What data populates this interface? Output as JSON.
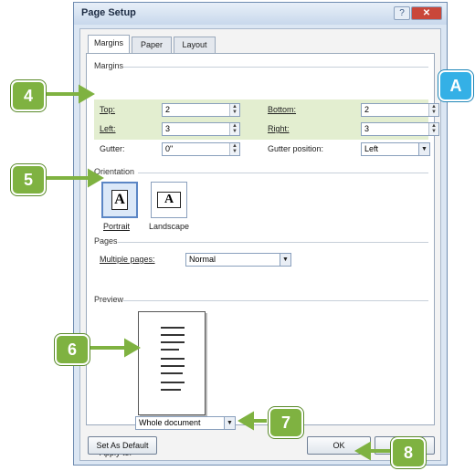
{
  "window": {
    "title": "Page Setup",
    "help": "?",
    "close": "✕"
  },
  "tabs": [
    {
      "label": "Margins"
    },
    {
      "label": "Paper"
    },
    {
      "label": "Layout"
    }
  ],
  "margins": {
    "group_label": "Margins",
    "top_label": "Top:",
    "top_value": "2",
    "bottom_label": "Bottom:",
    "bottom_value": "2",
    "left_label": "Left:",
    "left_value": "3",
    "right_label": "Right:",
    "right_value": "3",
    "gutter_label": "Gutter:",
    "gutter_value": "0\"",
    "gutter_position_label": "Gutter position:",
    "gutter_position_value": "Left"
  },
  "orientation": {
    "group_label": "Orientation",
    "portrait_label": "Portrait",
    "landscape_label": "Landscape",
    "glyph": "A"
  },
  "pages": {
    "group_label": "Pages",
    "multiple_pages_label": "Multiple pages:",
    "multiple_pages_value": "Normal"
  },
  "preview": {
    "group_label": "Preview"
  },
  "apply_to": {
    "label": "Apply to:",
    "value": "Whole document"
  },
  "buttons": {
    "set_as_default": "Set As Default",
    "ok": "OK",
    "cancel": "Cancel"
  },
  "callouts": {
    "c4": "4",
    "c5": "5",
    "c6": "6",
    "c7": "7",
    "c8": "8",
    "cA": "A"
  },
  "colors": {
    "callout_green": "#7fb241",
    "callout_blue": "#34b0e6",
    "highlight": "#e3eed0"
  }
}
